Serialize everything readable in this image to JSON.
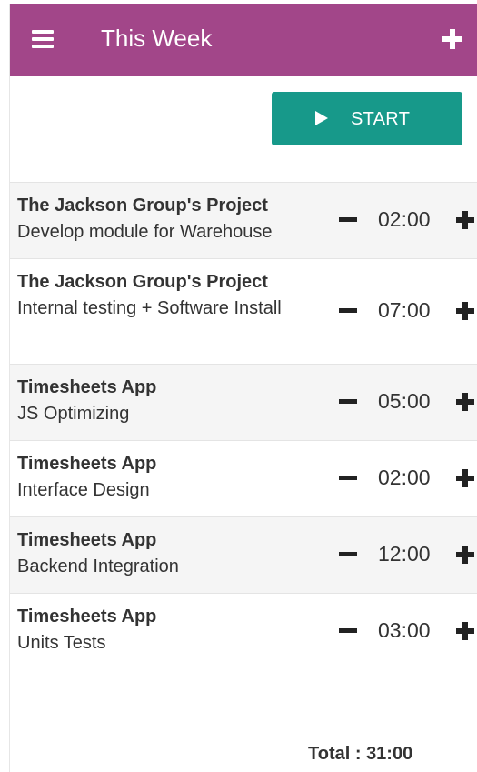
{
  "header": {
    "title": "This Week",
    "menu_icon": "hamburger-menu-icon",
    "add_icon": "plus-icon",
    "background": "#a24689"
  },
  "start_button": {
    "label": "START",
    "icon": "play-icon",
    "color": "#17998a"
  },
  "entries": [
    {
      "project": "The Jackson Group's Project",
      "task": "Develop module for Warehouse",
      "hours": "02:00"
    },
    {
      "project": "The Jackson Group's Project",
      "task": "Internal testing + Software Install",
      "hours": "07:00"
    },
    {
      "project": "Timesheets App",
      "task": "JS Optimizing",
      "hours": "05:00"
    },
    {
      "project": "Timesheets App",
      "task": "Interface Design",
      "hours": "02:00"
    },
    {
      "project": "Timesheets App",
      "task": "Backend Integration",
      "hours": "12:00"
    },
    {
      "project": "Timesheets App",
      "task": "Units Tests",
      "hours": "03:00"
    }
  ],
  "total": "Total : 31:00"
}
